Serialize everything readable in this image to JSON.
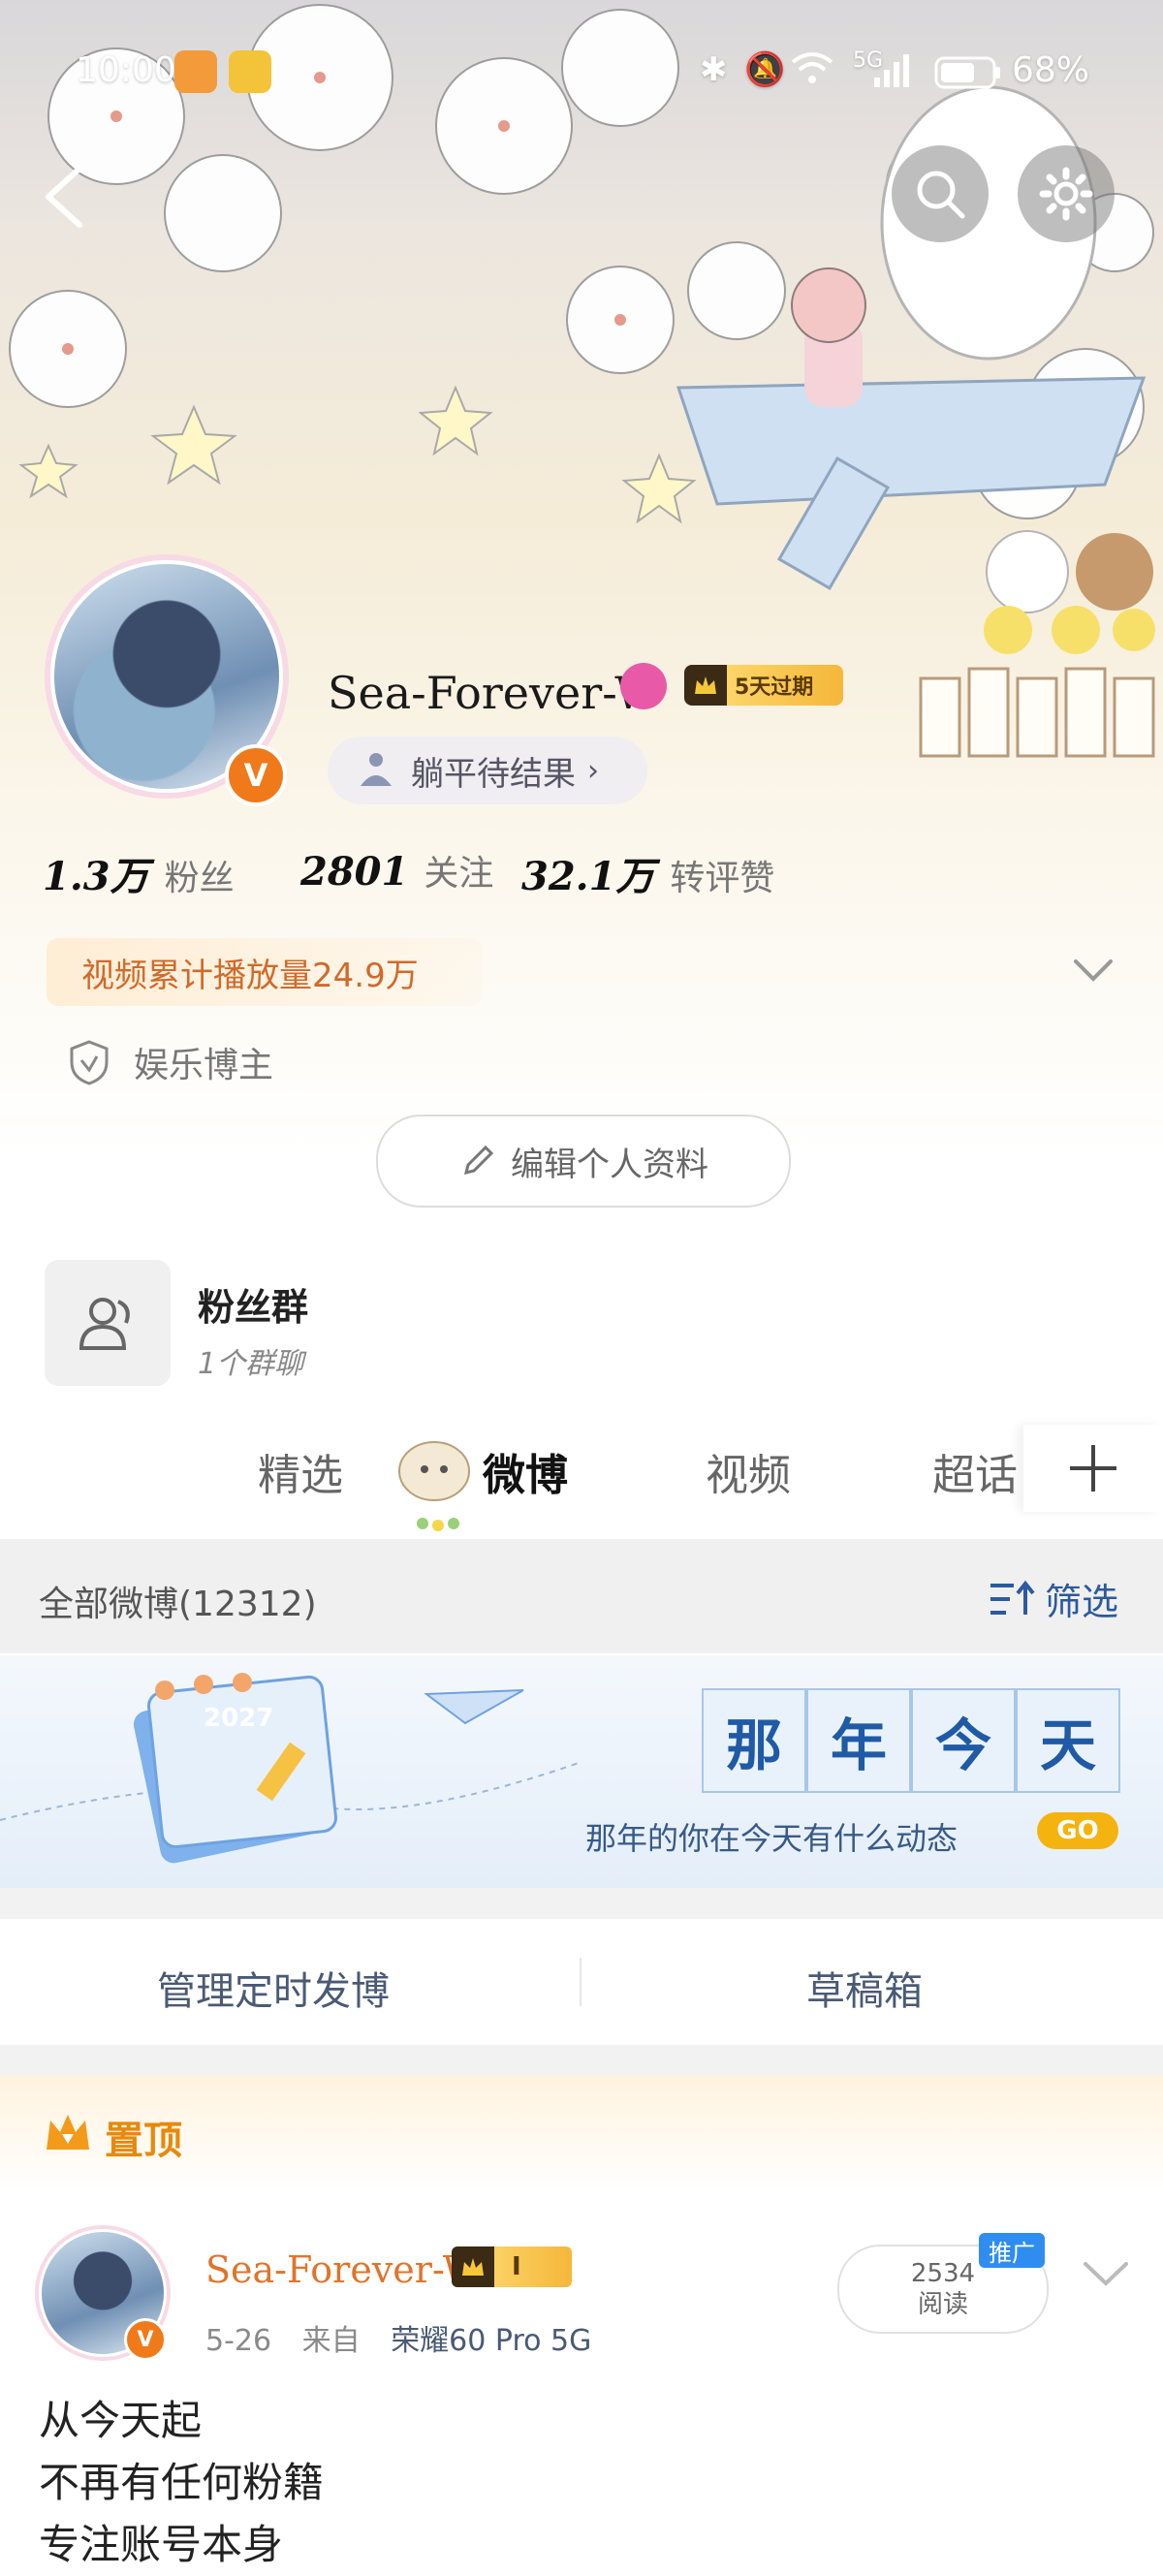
{
  "status_bar": {
    "time": "10:00",
    "battery": "68%",
    "network": "5G"
  },
  "profile": {
    "username": "Sea-Forever-W",
    "vip_label": "5天过期",
    "signature": "躺平待结果",
    "stats": [
      {
        "value": "1.3万",
        "label": "粉丝"
      },
      {
        "value": "2801",
        "label": "关注"
      },
      {
        "value": "32.1万",
        "label": "转评赞"
      }
    ],
    "video_note": "视频累计播放量24.9万",
    "tag": "娱乐博主",
    "edit_button": "编辑个人资料"
  },
  "fans_group": {
    "title": "粉丝群",
    "subtitle": "1个群聊"
  },
  "tabs": [
    {
      "label": "精选",
      "active": false
    },
    {
      "label": "微博",
      "active": true
    },
    {
      "label": "视频",
      "active": false
    },
    {
      "label": "超话",
      "active": false
    }
  ],
  "filter": {
    "all_label": "全部微博(12312)",
    "filter_label": "筛选"
  },
  "banner": {
    "chars": [
      "那",
      "年",
      "今",
      "天"
    ],
    "subtitle": "那年的你在今天有什么动态",
    "go": "GO",
    "calendar_year": "2027"
  },
  "actions": {
    "scheduled": "管理定时发博",
    "drafts": "草稿箱"
  },
  "pinned": {
    "label": "置顶",
    "username": "Sea-Forever-W",
    "level": "I",
    "date": "5-26",
    "from": "来自",
    "device": "荣耀60 Pro 5G",
    "reads_count": "2534",
    "reads_label": "阅读",
    "promo": "推广",
    "text_lines": [
      "从今天起",
      "不再有任何粉籍",
      "专注账号本身"
    ]
  },
  "colors": {
    "accent_orange": "#f07a1a",
    "link_blue": "#2a5aa0",
    "gold": "#f5b30f"
  }
}
